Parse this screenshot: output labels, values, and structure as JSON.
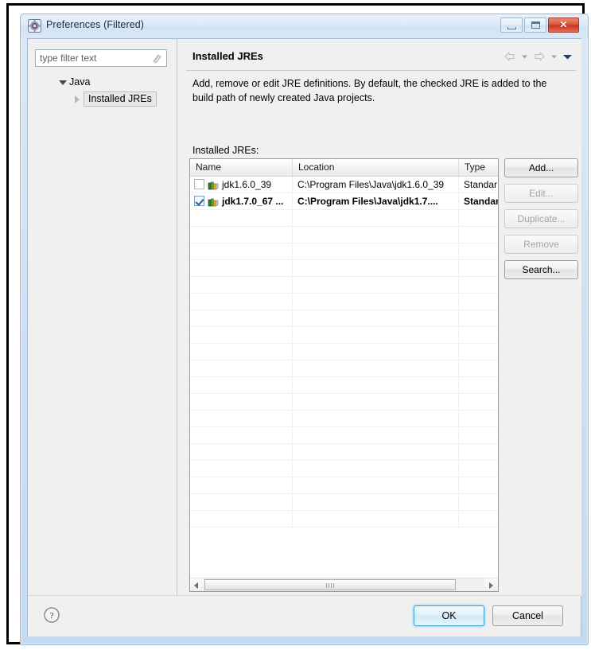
{
  "window": {
    "title": "Preferences (Filtered)",
    "icon": "preferences-gear-icon",
    "controls": {
      "minimize": "minimize-button",
      "maximize": "maximize-button",
      "close_glyph": "✕"
    }
  },
  "sidebar": {
    "filter": {
      "placeholder": "type filter text",
      "value": "type filter text",
      "clear_icon": "clear-filter-icon"
    },
    "tree": [
      {
        "label": "Java",
        "expanded": true,
        "level": 0,
        "selected": false
      },
      {
        "label": "Installed JREs",
        "expanded": false,
        "level": 1,
        "selected": true
      }
    ]
  },
  "page": {
    "title": "Installed JREs",
    "description": "Add, remove or edit JRE definitions. By default, the checked JRE is added to the build path of newly created Java projects.",
    "list_label": "Installed JREs:",
    "nav": {
      "back": "back-arrow-icon",
      "back_menu": "back-dropdown-icon",
      "forward": "forward-arrow-icon",
      "forward_menu": "forward-dropdown-icon",
      "view_menu": "view-menu-icon"
    }
  },
  "table": {
    "columns": [
      "Name",
      "Location",
      "Type"
    ],
    "rows": [
      {
        "checked": false,
        "bold": false,
        "name": "jdk1.6.0_39",
        "location": "C:\\Program Files\\Java\\jdk1.6.0_39",
        "type": "Standar"
      },
      {
        "checked": true,
        "bold": true,
        "name": "jdk1.7.0_67 ...",
        "location": "C:\\Program Files\\Java\\jdk1.7....",
        "type": "Standar"
      }
    ],
    "empty_row_count": 19,
    "scrollbar": {
      "left_arrow": "scroll-left-icon",
      "right_arrow": "scroll-right-icon",
      "grip": "scroll-thumb-grip"
    }
  },
  "side_buttons": [
    {
      "label": "Add...",
      "enabled": true
    },
    {
      "label": "Edit...",
      "enabled": false
    },
    {
      "label": "Duplicate...",
      "enabled": false
    },
    {
      "label": "Remove",
      "enabled": false
    },
    {
      "label": "Search...",
      "enabled": true
    }
  ],
  "footer": {
    "help_icon": "help-question-icon",
    "ok_label": "OK",
    "cancel_label": "Cancel"
  },
  "colors": {
    "accent": "#3c9fd6",
    "titlebar": "#dbe9f8",
    "close_button": "#c6341c",
    "window_border": "#8fb8dc"
  }
}
